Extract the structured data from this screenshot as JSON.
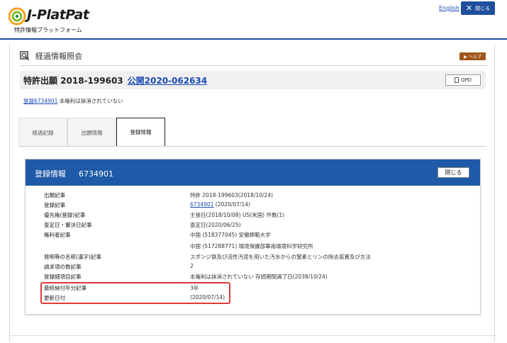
{
  "header": {
    "logo_text": "J-PlatPat",
    "logo_subtitle": "特許情報プラットフォーム",
    "lang_link": "English",
    "close_label": "閉じる"
  },
  "page": {
    "title": "経過情報照会",
    "help_label": "▶ ヘルプ"
  },
  "case": {
    "application": "特許出願 2018-199603",
    "publication": "公開2020-062634",
    "opd_label": "OPD"
  },
  "registration_status": {
    "link": "登録6734901",
    "text": "本権利は抹消されていない"
  },
  "tabs": [
    {
      "label": "経過記録"
    },
    {
      "label": "出願情報"
    },
    {
      "label": "登録情報"
    }
  ],
  "panel": {
    "title": "登録情報",
    "number": "6734901",
    "close_label": "閉じる"
  },
  "rows": [
    {
      "key": "出願記事",
      "value": "特許 2018-199603(2018/10/24)"
    },
    {
      "key": "登録記事",
      "value_link": "6734901",
      "value": " (2020/07/14)"
    },
    {
      "key": "優先権(登録)記事",
      "value": "主張日(2018/10/08) US(米国) 件数(1)"
    },
    {
      "key": "査定日・審決日記事",
      "value": "査定日(2020/06/25)"
    },
    {
      "key": "権利者記事",
      "value": "中国 (518377045) 安徽師範大学"
    },
    {
      "key": "",
      "value": "中国 (517288771) 環境保護部華南環境科学研究所"
    },
    {
      "key": "発明等の名称(漢字)記事",
      "value": "スポンジ鉄及び活性汚泥を用いた汚水からの窒素とリンの除去装置及び方法"
    },
    {
      "key": "請求項の数記事",
      "value": "2"
    },
    {
      "key": "登録細項目記事",
      "value": "本権利は抹消されていない 存続期間満了日(2038/10/24)"
    },
    {
      "key": "最終納付年分記事",
      "value": "3年"
    },
    {
      "key": "更新日付",
      "value": "(2020/07/14)"
    }
  ],
  "colors": {
    "brand_blue": "#1f5aa8",
    "help_orange": "#a0561a",
    "highlight_red": "#e03a3a"
  }
}
